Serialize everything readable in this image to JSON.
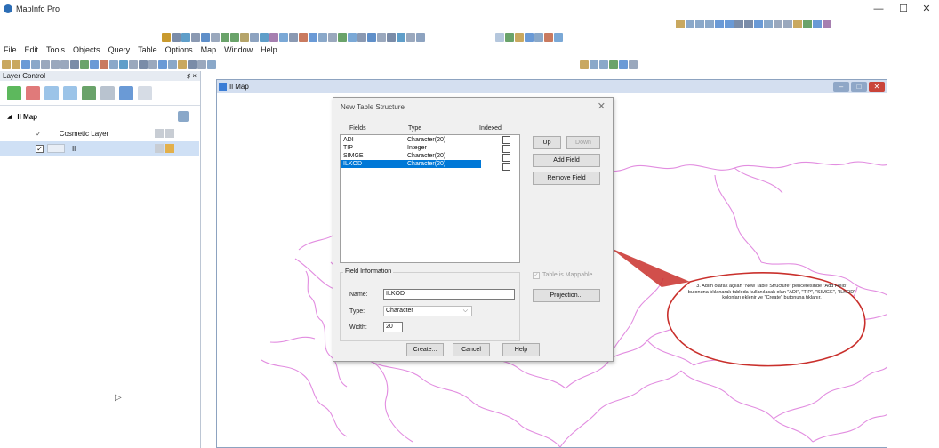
{
  "app": {
    "title": "MapInfo Pro"
  },
  "window_controls": {
    "minimize": "—",
    "maximize": "☐",
    "close": "✕"
  },
  "menu": {
    "items": [
      "File",
      "Edit",
      "Tools",
      "Objects",
      "Query",
      "Table",
      "Options",
      "Map",
      "Window",
      "Help"
    ]
  },
  "layer_control": {
    "title": "Layer Control",
    "pin": "♯ ×",
    "map_name": "Il Map",
    "layers": [
      {
        "name": "Cosmetic Layer",
        "checked": "✓"
      },
      {
        "name": "Il",
        "checked": "✓"
      }
    ]
  },
  "map_window": {
    "title": "Il Map"
  },
  "dialog": {
    "title": "New Table Structure",
    "close": "✕",
    "columns": {
      "fields": "Fields",
      "type": "Type",
      "indexed": "Indexed"
    },
    "fields": [
      {
        "name": "ADI",
        "type": "Character(20)",
        "selected": false
      },
      {
        "name": "TIP",
        "type": "Integer",
        "selected": false
      },
      {
        "name": "SIMGE",
        "type": "Character(20)",
        "selected": false
      },
      {
        "name": "ILKOD",
        "type": "Character(20)",
        "selected": true
      }
    ],
    "buttons": {
      "up": "Up",
      "down": "Down",
      "add_field": "Add Field",
      "remove_field": "Remove Field",
      "projection": "Projection...",
      "create": "Create...",
      "cancel": "Cancel",
      "help": "Help"
    },
    "field_info": {
      "group_label": "Field Information",
      "name_label": "Name:",
      "name_value": "ILKOD",
      "type_label": "Type:",
      "type_value": "Character",
      "width_label": "Width:",
      "width_value": "20"
    },
    "mappable_label": "Table is Mappable"
  },
  "callout": {
    "text": "3. Adım olarak açılan \"New Table Structure\" penceresinde \"Add Field\" butonuna tıklanarak tabloda kullanılacak olan \"ADI\", \"TIP\", \"SIMGE\", \"ILKOD\" kolonları eklenir ve \"Create\" butonuna tıklanır."
  },
  "colors": {
    "selection": "#0078d7",
    "map_boundaries": "#e28de0",
    "callout_border": "#c9302c"
  }
}
